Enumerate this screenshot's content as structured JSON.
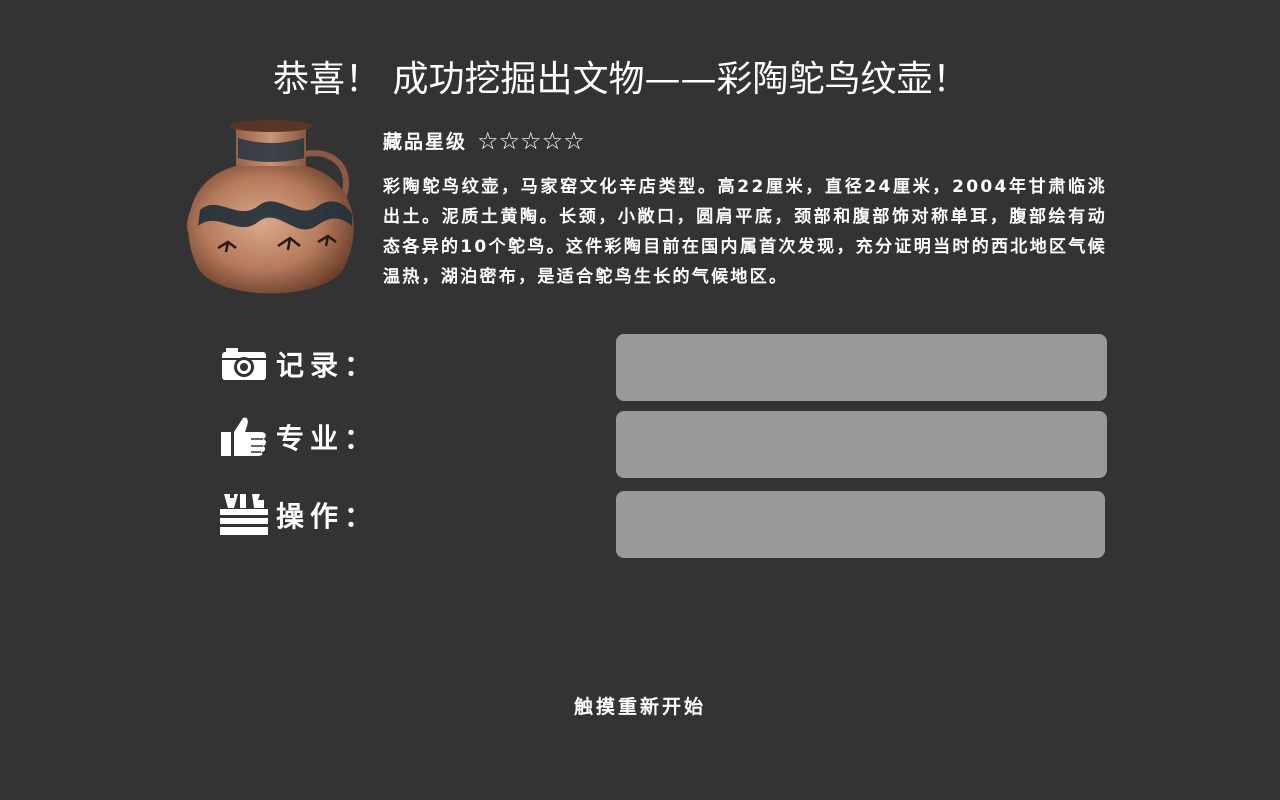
{
  "header": {
    "title": "恭喜！ 成功挖掘出文物——彩陶鸵鸟纹壶！"
  },
  "artifact": {
    "image_alt": "彩陶鸵鸟纹壶",
    "rating_label": "藏品星级",
    "stars_display": "☆☆☆☆☆",
    "star_count": 0,
    "star_max": 5,
    "description": "彩陶鸵鸟纹壶，马家窑文化辛店类型。高22厘米，直径24厘米，2004年甘肃临洮出土。泥质土黄陶。长颈，小敞口，圆肩平底，颈部和腹部饰对称单耳，腹部绘有动态各异的10个鸵鸟。这件彩陶目前在国内属首次发现，充分证明当时的西北地区气候温热，湖泊密布，是适合鸵鸟生长的气候地区。"
  },
  "stats": [
    {
      "label": "记录：",
      "icon": "camera-icon"
    },
    {
      "label": "专业：",
      "icon": "thumbs-up-icon"
    },
    {
      "label": "操作：",
      "icon": "toolbox-icon"
    }
  ],
  "footer": {
    "restart_label": "触摸重新开始"
  },
  "colors": {
    "background": "#333333",
    "text": "#ffffff",
    "bar": "#999999"
  }
}
